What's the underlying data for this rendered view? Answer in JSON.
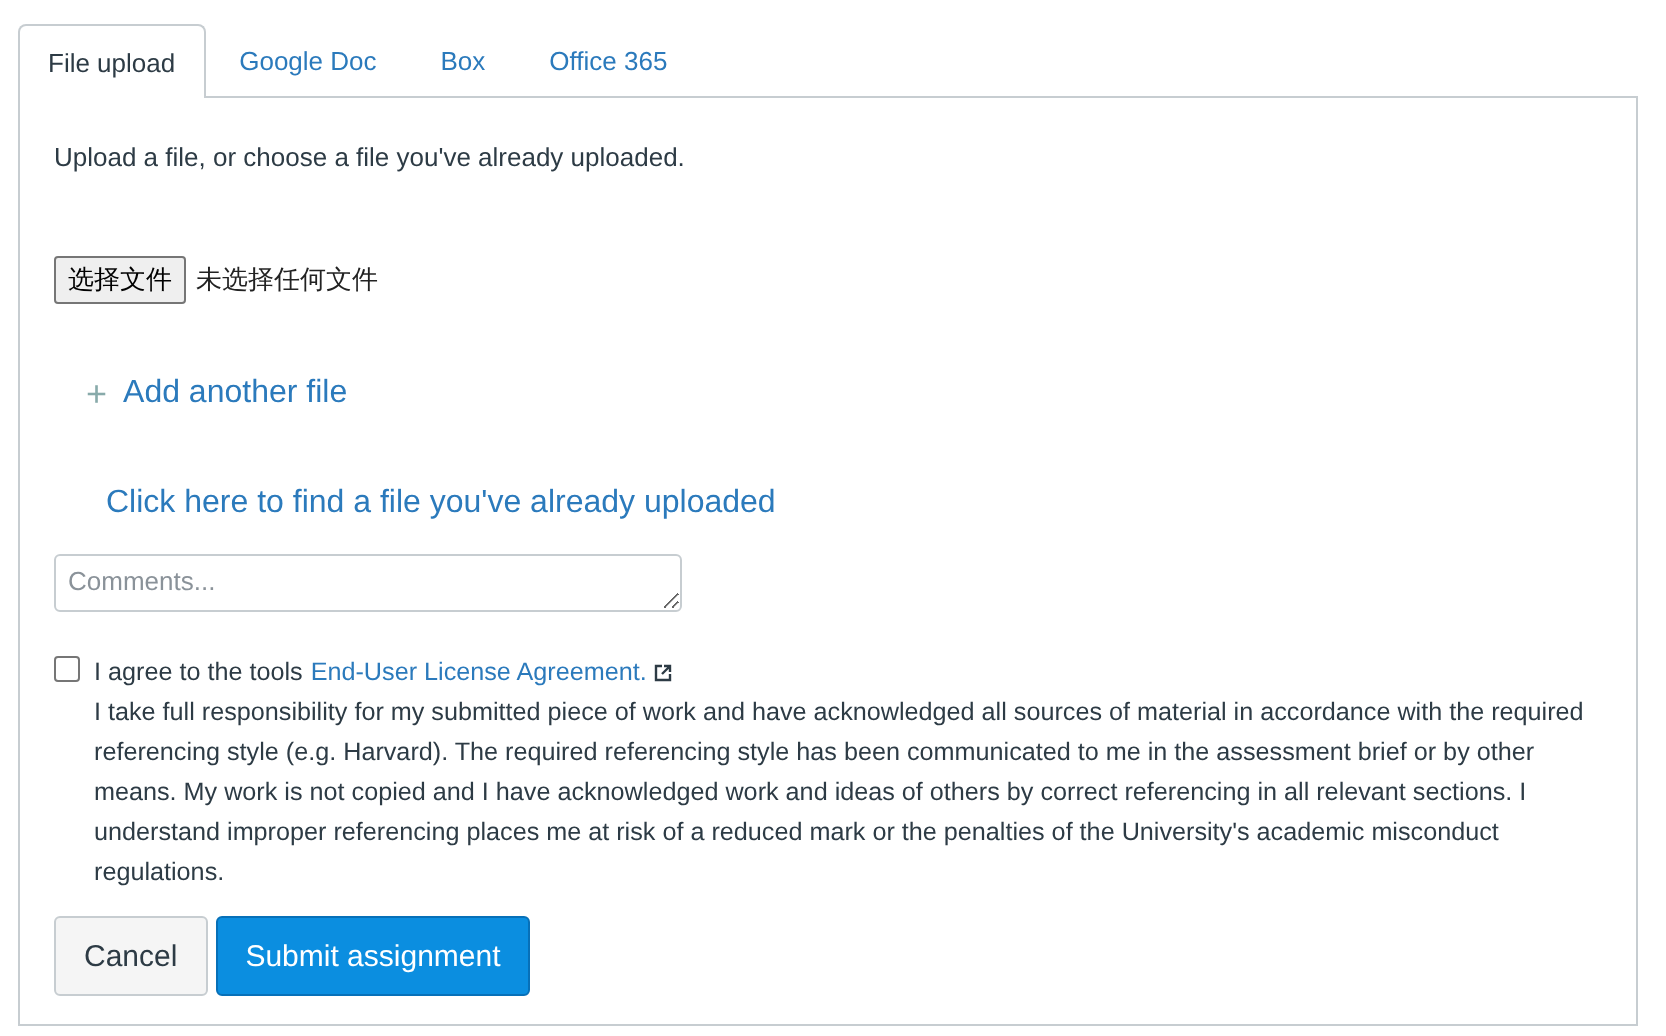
{
  "tabs": [
    {
      "label": "File upload",
      "selected": true
    },
    {
      "label": "Google Doc",
      "selected": false
    },
    {
      "label": "Box",
      "selected": false
    },
    {
      "label": "Office 365",
      "selected": false
    }
  ],
  "intro": "Upload a file, or choose a file you've already uploaded.",
  "file_input": {
    "button": "选择文件",
    "status": "未选择任何文件"
  },
  "add_file": {
    "icon": "+",
    "label": "Add another file"
  },
  "find_link": "Click here to find a file you've already uploaded",
  "comments": {
    "placeholder": "Comments..."
  },
  "agreement": {
    "checked": false,
    "label": "I agree to the tools",
    "link": "End-User License Agreement.",
    "text": "I take full responsibility for my submitted piece of work and have acknowledged all sources of material in accordance with the required referencing style (e.g. Harvard). The required referencing style has been communicated to me in the assessment brief or by other means. My work is not copied and I have acknowledged work and ideas of others by correct referencing in all relevant sections. I understand improper referencing places me at risk of a reduced mark or the penalties of the University's academic misconduct regulations."
  },
  "buttons": [
    {
      "label": "Cancel",
      "kind": "secondary"
    },
    {
      "label": "Submit assignment",
      "kind": "primary"
    }
  ]
}
